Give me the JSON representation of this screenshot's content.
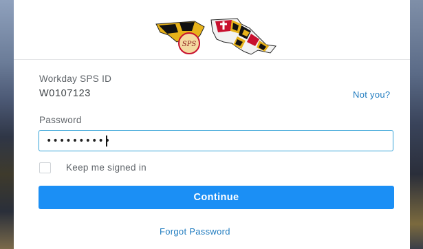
{
  "logo": {
    "badge_text": "SPS",
    "icon": "maryland-state-logo"
  },
  "account": {
    "id_label": "Workday SPS ID",
    "id_value": "W0107123",
    "not_you_link": "Not you?"
  },
  "password": {
    "label": "Password",
    "masked_value": "••••••••••"
  },
  "remember": {
    "label": "Keep me signed in",
    "checked": false
  },
  "actions": {
    "continue_label": "Continue",
    "forgot_link": "Forgot Password"
  },
  "colors": {
    "primary": "#1b8ff5",
    "link": "#1f7bbf",
    "focus_border": "#2fa0d6"
  }
}
